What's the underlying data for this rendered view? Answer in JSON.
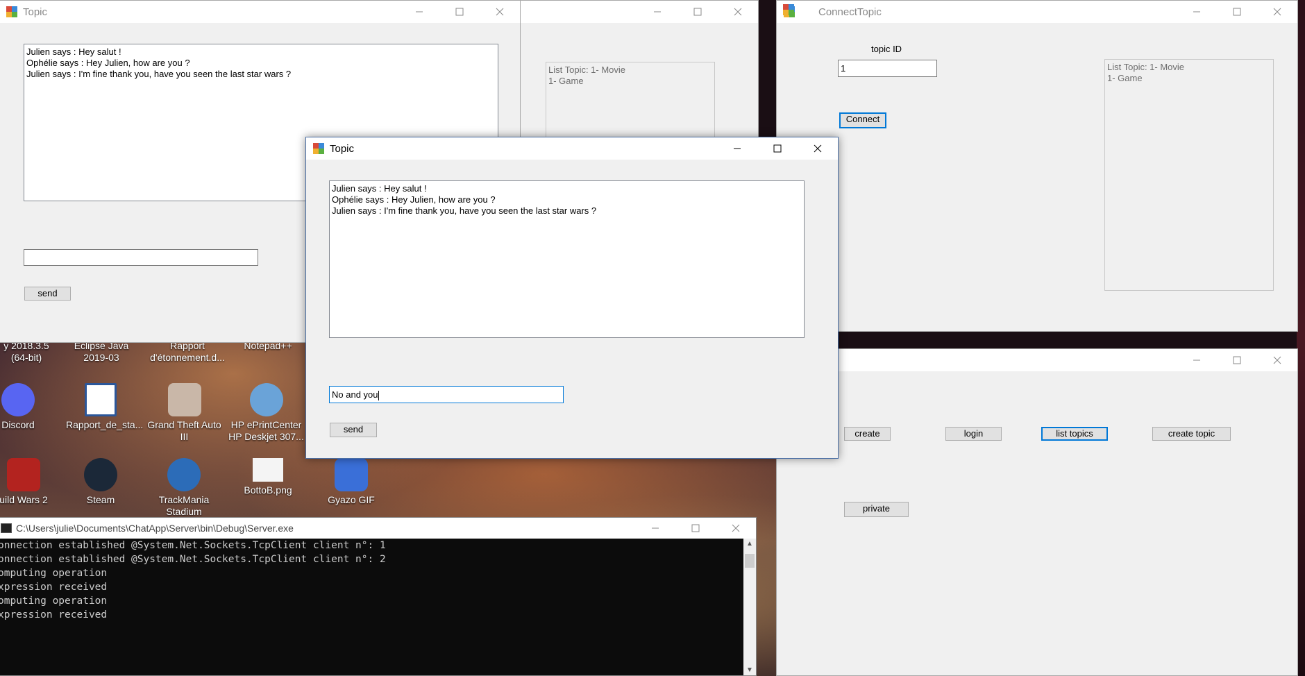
{
  "desktop": {
    "icons": [
      {
        "id": "icon-intellij",
        "label": "y 2018.3.5 (64-bit)",
        "line2": ""
      },
      {
        "id": "icon-eclipse",
        "label": "Eclipse Java",
        "line2": "2019-03"
      },
      {
        "id": "icon-rapport1",
        "label": "Rapport",
        "line2": "d'étonnement.d..."
      },
      {
        "id": "icon-notepad",
        "label": "Notepad++",
        "line2": ""
      },
      {
        "id": "icon-discord",
        "label": "Discord",
        "line2": ""
      },
      {
        "id": "icon-rapport2",
        "label": "Rapport_de_sta...",
        "line2": ""
      },
      {
        "id": "icon-gta",
        "label": "Grand Theft Auto",
        "line2": "III"
      },
      {
        "id": "icon-hp",
        "label": "HP ePrintCenter",
        "line2": "HP Deskjet 307..."
      },
      {
        "id": "icon-guildwars",
        "label": "uild Wars 2",
        "line2": ""
      },
      {
        "id": "icon-steam",
        "label": "Steam",
        "line2": ""
      },
      {
        "id": "icon-trackmania",
        "label": "TrackMania",
        "line2": "Stadium"
      },
      {
        "id": "icon-botto",
        "label": "BottoB.png",
        "line2": ""
      },
      {
        "id": "icon-gyazo",
        "label": "Gyazo GIF",
        "line2": ""
      }
    ]
  },
  "topic_back": {
    "title": "Topic",
    "messages": [
      "Julien says : Hey salut !",
      "Ophélie says : Hey Julien, how are you ?",
      "Julien says : I'm fine thank you, have you seen the last star wars ?"
    ],
    "input_value": "",
    "send_label": "send"
  },
  "list_window": {
    "list_lines": [
      "List Topic: 1- Movie",
      "1- Game"
    ]
  },
  "connect_topic": {
    "title": "ConnectTopic",
    "topic_id_label": "topic ID",
    "topic_id_value": "1",
    "connect_label": "Connect",
    "list_lines": [
      "List Topic: 1- Movie",
      "1- Game"
    ]
  },
  "main_menu": {
    "create_label": "create",
    "login_label": "login",
    "list_topics_label": "list topics",
    "create_topic_label": "create topic",
    "private_label": "private"
  },
  "topic_front": {
    "title": "Topic",
    "messages": [
      "Julien says : Hey salut !",
      "Ophélie says : Hey Julien, how are you ?",
      "Julien says : I'm fine thank you, have you seen the last star wars ?"
    ],
    "input_value": "No and you",
    "send_label": "send"
  },
  "console": {
    "title": "C:\\Users\\julie\\Documents\\ChatApp\\Server\\bin\\Debug\\Server.exe",
    "lines": [
      "onnection established @System.Net.Sockets.TcpClient client n°: 1",
      "onnection established @System.Net.Sockets.TcpClient client n°: 2",
      "omputing operation",
      "xpression received",
      "omputing operation",
      "xpression received"
    ]
  },
  "colors": {
    "accent": "#0078d7",
    "console_bg": "#0c0c0c",
    "window_bg": "#f0f0f0"
  }
}
